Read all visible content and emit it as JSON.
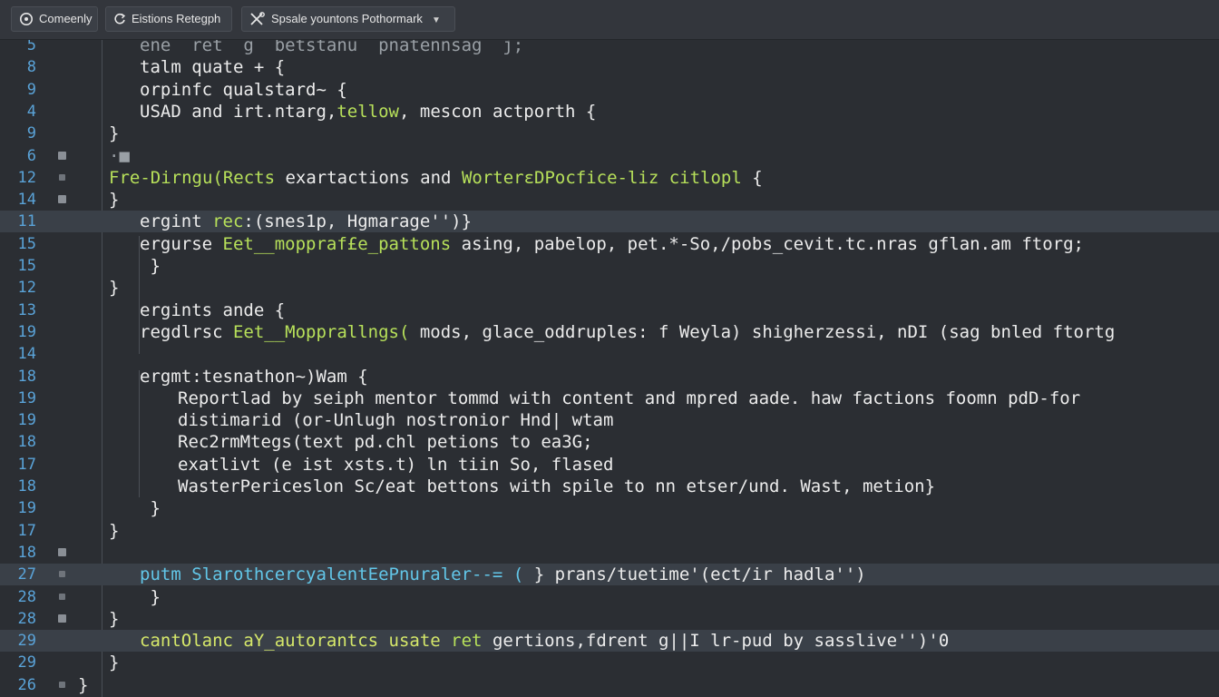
{
  "toolbar": {
    "btn1_label": "Comeenly",
    "btn2_label": "Eistions Retegph",
    "btn3_label": "Spsale yountons Pothormark"
  },
  "lines": [
    {
      "num": "5",
      "indent": 2,
      "marker": "none",
      "highlight": false,
      "segments": [
        {
          "text": "ene  ret  g  betstanu  pnatennsag  j;",
          "color": "dim"
        }
      ]
    },
    {
      "num": "8",
      "indent": 2,
      "marker": "none",
      "highlight": false,
      "segments": [
        {
          "text": "talm quate + {",
          "color": "white"
        }
      ]
    },
    {
      "num": "9",
      "indent": 2,
      "marker": "none",
      "highlight": false,
      "segments": [
        {
          "text": "orpinfc qualstard~ {",
          "color": "white"
        }
      ]
    },
    {
      "num": "4",
      "indent": 2,
      "marker": "none",
      "highlight": false,
      "segments": [
        {
          "text": "USAD ",
          "color": "white"
        },
        {
          "text": "and irt.ntarg,",
          "color": "white"
        },
        {
          "text": "tellow",
          "color": "green"
        },
        {
          "text": ", mescon actporth {",
          "color": "white"
        }
      ]
    },
    {
      "num": "9",
      "indent": 1,
      "marker": "none",
      "highlight": false,
      "segments": [
        {
          "text": "}",
          "color": "white"
        }
      ]
    },
    {
      "num": "6",
      "indent": 1,
      "marker": "box",
      "highlight": false,
      "segments": [
        {
          "text": "·■",
          "color": "dim"
        }
      ]
    },
    {
      "num": "12",
      "indent": 1,
      "marker": "small",
      "highlight": false,
      "segments": [
        {
          "text": "Fre-Dirngu(Rects",
          "color": "green"
        },
        {
          "text": " exartactions and ",
          "color": "white"
        },
        {
          "text": "WorterεDPocfice-liz citlopl",
          "color": "green"
        },
        {
          "text": " {",
          "color": "white"
        }
      ]
    },
    {
      "num": "14",
      "indent": 1,
      "marker": "box",
      "highlight": false,
      "segments": [
        {
          "text": "}",
          "color": "white"
        }
      ]
    },
    {
      "num": "11",
      "indent": 2,
      "marker": "none",
      "highlight": true,
      "segments": [
        {
          "text": "ergint ",
          "color": "white"
        },
        {
          "text": "rec",
          "color": "green"
        },
        {
          "text": ":(snes1p, Hgmarage'')}",
          "color": "white"
        }
      ]
    },
    {
      "num": "15",
      "indent": 2,
      "marker": "none",
      "highlight": false,
      "segments": [
        {
          "text": "ergurse ",
          "color": "white"
        },
        {
          "text": "Eet__moppraf£e_pattons",
          "color": "green"
        },
        {
          "text": " asing, pabelop, pet.*-So,/pobs_cevit.tc.nras gflan.am ftorg;",
          "color": "white"
        }
      ]
    },
    {
      "num": "15",
      "indent": 2,
      "marker": "none",
      "highlight": false,
      "segments": [
        {
          "text": " }",
          "color": "white"
        }
      ]
    },
    {
      "num": "12",
      "indent": 1,
      "marker": "none",
      "highlight": false,
      "segments": [
        {
          "text": "}",
          "color": "white"
        }
      ]
    },
    {
      "num": "13",
      "indent": 2,
      "marker": "none",
      "highlight": false,
      "segments": [
        {
          "text": "ergints ande {",
          "color": "white"
        }
      ]
    },
    {
      "num": "19",
      "indent": 2,
      "marker": "none",
      "highlight": false,
      "segments": [
        {
          "text": "regdlrsc ",
          "color": "white"
        },
        {
          "text": "Eet__Mopprallngs(",
          "color": "green"
        },
        {
          "text": " mods, glace_oddruples: f Weyla) shigherzessi, nDI (sag bnled ftortg",
          "color": "white"
        }
      ]
    },
    {
      "num": "14",
      "indent": 2,
      "marker": "none",
      "highlight": false,
      "segments": [
        {
          "text": "",
          "color": "white"
        }
      ]
    },
    {
      "num": "18",
      "indent": 2,
      "marker": "none",
      "highlight": false,
      "segments": [
        {
          "text": "ergmt:tesnathon~)Wam {",
          "color": "white"
        }
      ]
    },
    {
      "num": "19",
      "indent": 3,
      "marker": "none",
      "highlight": false,
      "segments": [
        {
          "text": "Reportlad by seiph mentor tommd with content and mpred aade. haw factions foomn pdD-for",
          "color": "white"
        }
      ]
    },
    {
      "num": "19",
      "indent": 3,
      "marker": "none",
      "highlight": false,
      "segments": [
        {
          "text": "distimarid (or-Unlugh nostronior Hnd| wtam",
          "color": "white"
        }
      ]
    },
    {
      "num": "18",
      "indent": 3,
      "marker": "none",
      "highlight": false,
      "segments": [
        {
          "text": "Rec2rmMtegs(text pd.chl petions to ea3G;",
          "color": "white"
        }
      ]
    },
    {
      "num": "17",
      "indent": 3,
      "marker": "none",
      "highlight": false,
      "segments": [
        {
          "text": "exatlivt (e ist xsts.t) ln tiin So, flased",
          "color": "white"
        }
      ]
    },
    {
      "num": "18",
      "indent": 3,
      "marker": "none",
      "highlight": false,
      "segments": [
        {
          "text": "WasterPericeslon Sc/eat bettons with spile to nn etser/und. Wast, metion}",
          "color": "white"
        }
      ]
    },
    {
      "num": "19",
      "indent": 2,
      "marker": "none",
      "highlight": false,
      "segments": [
        {
          "text": " }",
          "color": "white"
        }
      ]
    },
    {
      "num": "17",
      "indent": 1,
      "marker": "none",
      "highlight": false,
      "segments": [
        {
          "text": "}",
          "color": "white"
        }
      ]
    },
    {
      "num": "18",
      "indent": 1,
      "marker": "box",
      "highlight": false,
      "segments": [
        {
          "text": "",
          "color": "white"
        }
      ]
    },
    {
      "num": "27",
      "indent": 2,
      "marker": "small",
      "highlight": true,
      "segments": [
        {
          "text": "putm ",
          "color": "cyan"
        },
        {
          "text": "SlarothcercyalentEePnuraler--= ( ",
          "color": "cyan"
        },
        {
          "text": "} prans/tuetime'(ect/ir hadla'')",
          "color": "white"
        }
      ]
    },
    {
      "num": "28",
      "indent": 2,
      "marker": "small",
      "highlight": false,
      "segments": [
        {
          "text": " }",
          "color": "white"
        }
      ]
    },
    {
      "num": "28",
      "indent": 1,
      "marker": "box",
      "highlight": false,
      "segments": [
        {
          "text": "}",
          "color": "white"
        }
      ]
    },
    {
      "num": "29",
      "indent": 2,
      "marker": "none",
      "highlight": true,
      "segments": [
        {
          "text": "cantOlanc aY_autorantcs usate ",
          "color": "lime"
        },
        {
          "text": "ret",
          "color": "green"
        },
        {
          "text": " gertions,fdrent g||I lr-pud by sasslive'')'0",
          "color": "white"
        }
      ]
    },
    {
      "num": "29",
      "indent": 1,
      "marker": "none",
      "highlight": false,
      "segments": [
        {
          "text": "}",
          "color": "white"
        }
      ]
    },
    {
      "num": "26",
      "indent": 0,
      "marker": "small",
      "highlight": false,
      "segments": [
        {
          "text": "}",
          "color": "white"
        }
      ]
    }
  ]
}
